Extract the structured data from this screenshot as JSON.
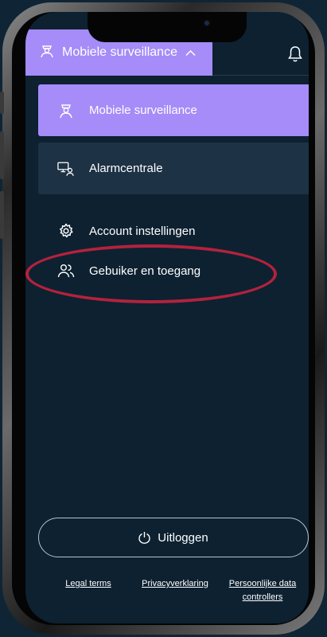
{
  "header": {
    "title": "Mobiele surveillance",
    "title_icon": "guard-icon",
    "chevron_icon": "chevron-up-icon",
    "notification_icon": "bell-icon"
  },
  "menu": {
    "cards": [
      {
        "label": "Mobiele surveillance",
        "icon": "guard-icon",
        "active": true
      },
      {
        "label": "Alarmcentrale",
        "icon": "monitor-user-icon",
        "active": false
      }
    ],
    "links": [
      {
        "label": "Account instellingen",
        "icon": "gear-icon"
      },
      {
        "label": "Gebuiker en toegang",
        "icon": "users-icon"
      }
    ]
  },
  "logout": {
    "label": "Uitloggen",
    "icon": "power-icon"
  },
  "footer": {
    "links": [
      {
        "label": "Legal terms"
      },
      {
        "label": "Privacyverklaring"
      },
      {
        "label": "Persoonlijke data controllers"
      }
    ]
  },
  "colors": {
    "background": "#0d2131",
    "accent": "#a58cf8",
    "card": "#1d3244",
    "annotation": "#b3223c"
  }
}
